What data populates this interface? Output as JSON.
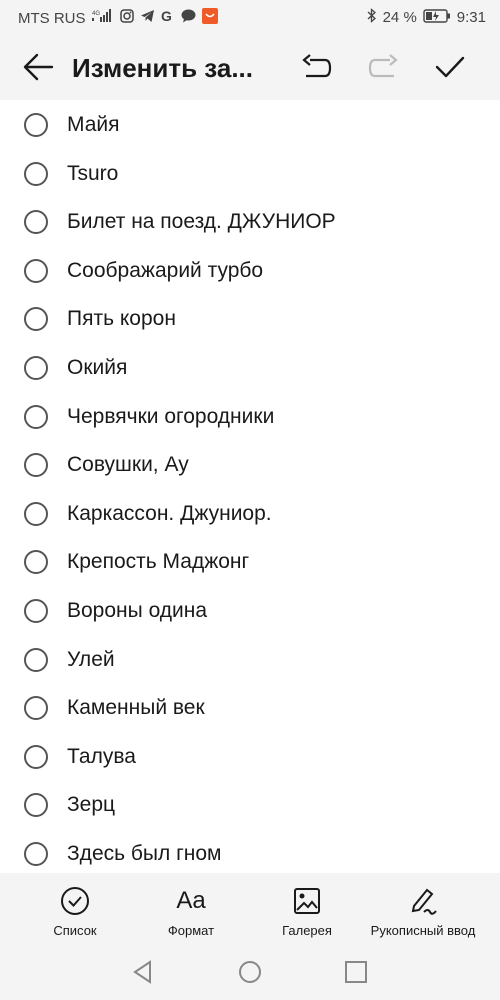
{
  "status": {
    "carrier": "MTS RUS",
    "network": "4G",
    "battery": "24 %",
    "time": "9:31"
  },
  "appbar": {
    "title": "Изменить за..."
  },
  "checklist": [
    "Майя",
    "Tsuro",
    "Билет на поезд. ДЖУНИОР",
    "Соображарий турбо",
    "Пять корон",
    "Окийя",
    "Червячки огородники",
    "Совушки, Ау",
    "Каркассон. Джуниор.",
    "Крепость Маджонг",
    "Вороны одина",
    "Улей",
    "Каменный век",
    "Талува",
    "Зерц",
    "Здесь был гном"
  ],
  "toolbar": {
    "list_label": "Список",
    "format_label": "Формат",
    "gallery_label": "Галерея",
    "handwriting_label": "Рукописный ввод",
    "format_icon_text": "Aa"
  },
  "colors": {
    "background": "#f4f4f4",
    "list_background": "#ffffff",
    "text": "#1a1a1a",
    "radio_border": "#555555",
    "disabled_icon": "#bbbbbb"
  }
}
